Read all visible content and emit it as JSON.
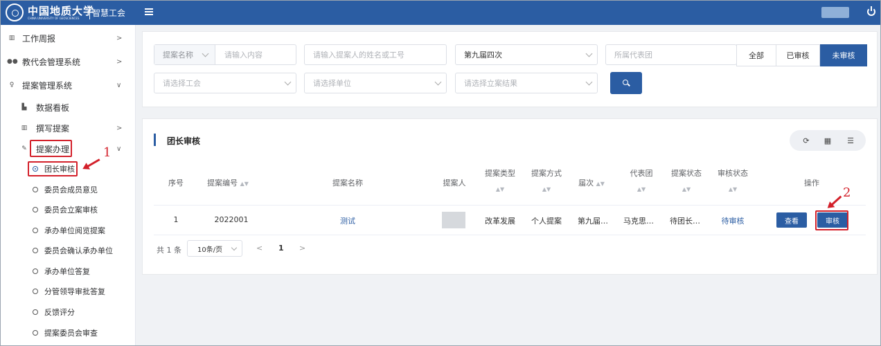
{
  "header": {
    "logo_cn": "中国地质大学",
    "logo_en": "CHINA UNIVERSITY OF GEOSCIENCES",
    "app_name": "智慧工会",
    "brand_color": "#2b5da3"
  },
  "sidebar": {
    "items": [
      {
        "label": "工作周报",
        "icon": "book-icon",
        "arrow": ">"
      },
      {
        "label": "教代会管理系统",
        "icon": "users-icon",
        "arrow": ">"
      },
      {
        "label": "提案管理系统",
        "icon": "bulb-icon",
        "arrow": "∨"
      }
    ],
    "sub_items": [
      {
        "label": "数据看板",
        "icon": "bar-chart-icon",
        "arrow": ""
      },
      {
        "label": "撰写提案",
        "icon": "book-icon",
        "arrow": ">"
      },
      {
        "label": "提案办理",
        "icon": "edit-icon",
        "arrow": "∨"
      }
    ],
    "leaf_items": [
      {
        "label": "团长审核",
        "active": true
      },
      {
        "label": "委员会成员意见"
      },
      {
        "label": "委员会立案审核"
      },
      {
        "label": "承办单位阅览提案"
      },
      {
        "label": "委员会确认承办单位"
      },
      {
        "label": "承办单位答复"
      },
      {
        "label": "分管领导审批答复"
      },
      {
        "label": "反馈评分"
      },
      {
        "label": "提案委员会审查"
      }
    ]
  },
  "annotations": {
    "step1": "1",
    "step2": "2",
    "color": "#d3202a"
  },
  "filters": {
    "name_prefix": "提案名称",
    "name_placeholder": "请输入内容",
    "person_placeholder": "请输入提案人的姓名或工号",
    "session_value": "第九届四次",
    "delegation_placeholder": "所属代表团",
    "status_tabs": [
      "全部",
      "已审核",
      "未审核"
    ],
    "status_selected": "未审核",
    "union_placeholder": "请选择工会",
    "unit_placeholder": "请选择单位",
    "result_placeholder": "请选择立案结果"
  },
  "table": {
    "title": "团长审核",
    "columns": [
      "序号",
      "提案编号",
      "提案名称",
      "提案人",
      "提案类型",
      "提案方式",
      "届次",
      "代表团",
      "提案状态",
      "审核状态",
      "操作"
    ],
    "rows": [
      {
        "index": "1",
        "code": "2022001",
        "name": "测试",
        "type": "改革发展",
        "mode": "个人提案",
        "session": "第九届…",
        "delegation": "马克思…",
        "status": "待团长…",
        "review": "待审核"
      }
    ],
    "actions": {
      "view": "查看",
      "review": "审核"
    }
  },
  "pager": {
    "total": "共 1 条",
    "size": "10条/页",
    "prev": "<",
    "current": "1",
    "next": ">"
  }
}
